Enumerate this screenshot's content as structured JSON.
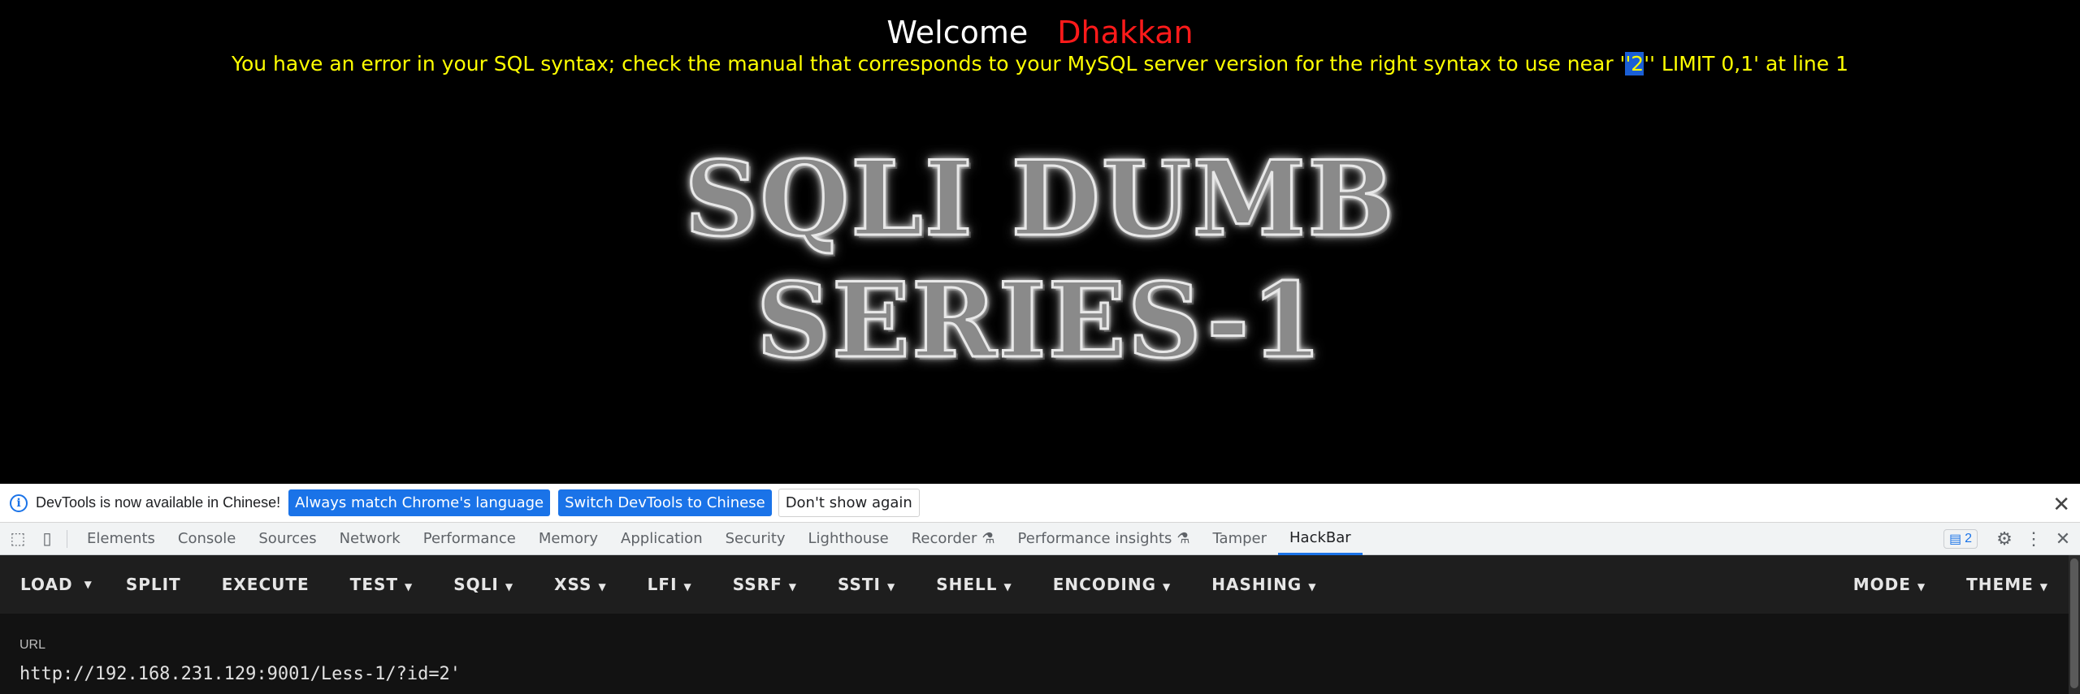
{
  "page": {
    "welcome_label": "Welcome",
    "username": "Dhakkan",
    "error_prefix": "You have an error in your SQL syntax; check the manual that corresponds to your MySQL server version for the right syntax to use near '",
    "error_highlight": "'2",
    "error_suffix": "'' LIMIT 0,1' at line 1",
    "banner": "SQLI DUMB SERIES-1"
  },
  "infobar": {
    "message": "DevTools is now available in Chinese!",
    "btn_match": "Always match Chrome's language",
    "btn_switch": "Switch DevTools to Chinese",
    "btn_dismiss": "Don't show again"
  },
  "tabs": [
    "Elements",
    "Console",
    "Sources",
    "Network",
    "Performance",
    "Memory",
    "Application",
    "Security",
    "Lighthouse",
    "Recorder",
    "Performance insights",
    "Tamper",
    "HackBar"
  ],
  "issues_count": "2",
  "hackbar": {
    "load": "LOAD",
    "split": "SPLIT",
    "execute": "EXECUTE",
    "test": "TEST",
    "sqli": "SQLI",
    "xss": "XSS",
    "lfi": "LFI",
    "ssrf": "SSRF",
    "ssti": "SSTI",
    "shell": "SHELL",
    "encoding": "ENCODING",
    "hashing": "HASHING",
    "mode": "MODE",
    "theme": "THEME"
  },
  "url": {
    "label": "URL",
    "value": "http://192.168.231.129:9001/Less-1/?id=2'"
  },
  "colors": {
    "username": "#ff1a1a",
    "error_text": "#ffff00",
    "accent": "#1a73e8",
    "hackbar_bg": "#1e1e1e"
  }
}
